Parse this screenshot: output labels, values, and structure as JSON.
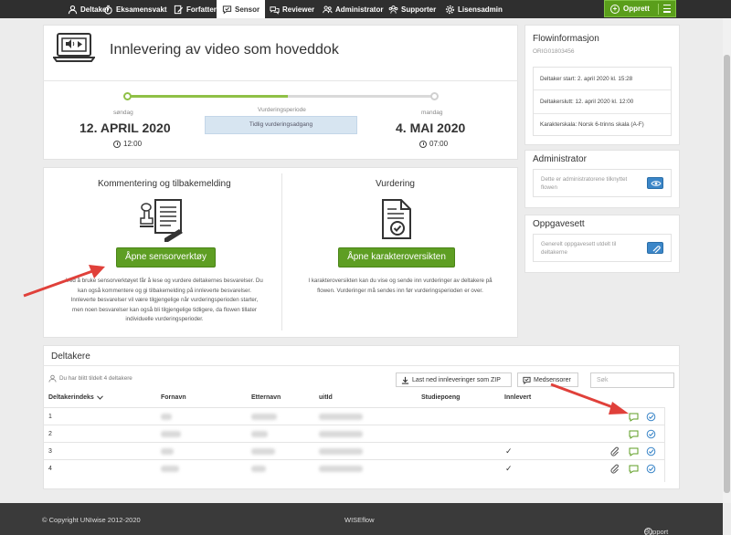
{
  "nav": {
    "items": [
      {
        "label": "Deltaker",
        "icon": "person-icon"
      },
      {
        "label": "Eksamensvakt",
        "icon": "stopwatch-icon"
      },
      {
        "label": "Forfatter",
        "icon": "edit-document-icon"
      },
      {
        "label": "Sensor",
        "icon": "chat-check-icon"
      },
      {
        "label": "Reviewer",
        "icon": "review-icon"
      },
      {
        "label": "Administrator",
        "icon": "people-icon"
      },
      {
        "label": "Supporter",
        "icon": "group-icon"
      },
      {
        "label": "Lisensadmin",
        "icon": "gear-icon"
      }
    ],
    "active": "Sensor",
    "create_label": "Opprett"
  },
  "header": {
    "title": "Innlevering av video som hoveddok",
    "period_label": "Vurderingsperiode",
    "early_label": "Tidlig vurderingsadgang",
    "start": {
      "weekday": "søndag",
      "date": "12. APRIL 2020",
      "time": "12:00"
    },
    "end": {
      "weekday": "mandag",
      "date": "4. MAI 2020",
      "time": "07:00"
    }
  },
  "sections": {
    "left": {
      "title": "Kommentering og tilbakemelding",
      "button": "Åpne sensorverktøy",
      "desc": [
        "Ved å bruke sensorverktøyet får å lese og vurdere deltakernes besvarelser. Du",
        "kan også kommentere og gi tilbakemelding på innleverte besvarelser.",
        "Innleverte besvarelser vil være tilgjengelige når vurderingsperioden starter,",
        "men noen besvarelser kan også bli tilgjengelige tidligere, da flowen tillater",
        "individuelle vurderingsperioder."
      ]
    },
    "right": {
      "title": "Vurdering",
      "button": "Åpne karakteroversikten",
      "desc": [
        "I karakteroversikten kan du vise og sende inn vurderinger av deltakere på",
        "flowen. Vurderinger må sendes inn før vurderingsperioden er over."
      ]
    }
  },
  "flowinfo": {
    "title": "Flowinformasjon",
    "code": "ORIG01803456",
    "start": "Deltaker start: 2. april 2020 kl. 15:28",
    "end": "Deltakerslutt: 12. april 2020 kl. 12:00",
    "scale": "Karakterskala: Norsk 6-trinns skala (A-F)"
  },
  "administrator": {
    "title": "Administrator",
    "desc": "Dette er administratorene tilknyttet flowen"
  },
  "oppgavesett": {
    "title": "Oppgavesett",
    "desc": "Generelt oppgavesett utdelt til deltakerne"
  },
  "participants": {
    "title": "Deltakere",
    "assigned": "Du har blitt tildelt 4 deltakere",
    "download_label": "Last ned innleveringer som ZIP",
    "co_sensor_label": "Medsensorer",
    "search_placeholder": "Søk",
    "columns": [
      "Deltakerindeks",
      "Fornavn",
      "Etternavn",
      "uitId",
      "Studiepoeng",
      "Innlevert"
    ],
    "rows": [
      {
        "index": "1",
        "submitted": "",
        "attachment": false
      },
      {
        "index": "2",
        "submitted": "",
        "attachment": false
      },
      {
        "index": "3",
        "submitted": "✓",
        "attachment": true
      },
      {
        "index": "4",
        "submitted": "✓",
        "attachment": true
      }
    ]
  },
  "footer": {
    "copyright": "© Copyright UNIwise 2012-2020",
    "brand": "WISEflow",
    "support": "Support"
  },
  "colors": {
    "accent_green": "#5e9e23",
    "timeline_green": "#8fc046",
    "blue": "#3b86c8",
    "nav_bg": "#2f2f2f",
    "arrow_red": "#e0403a"
  }
}
